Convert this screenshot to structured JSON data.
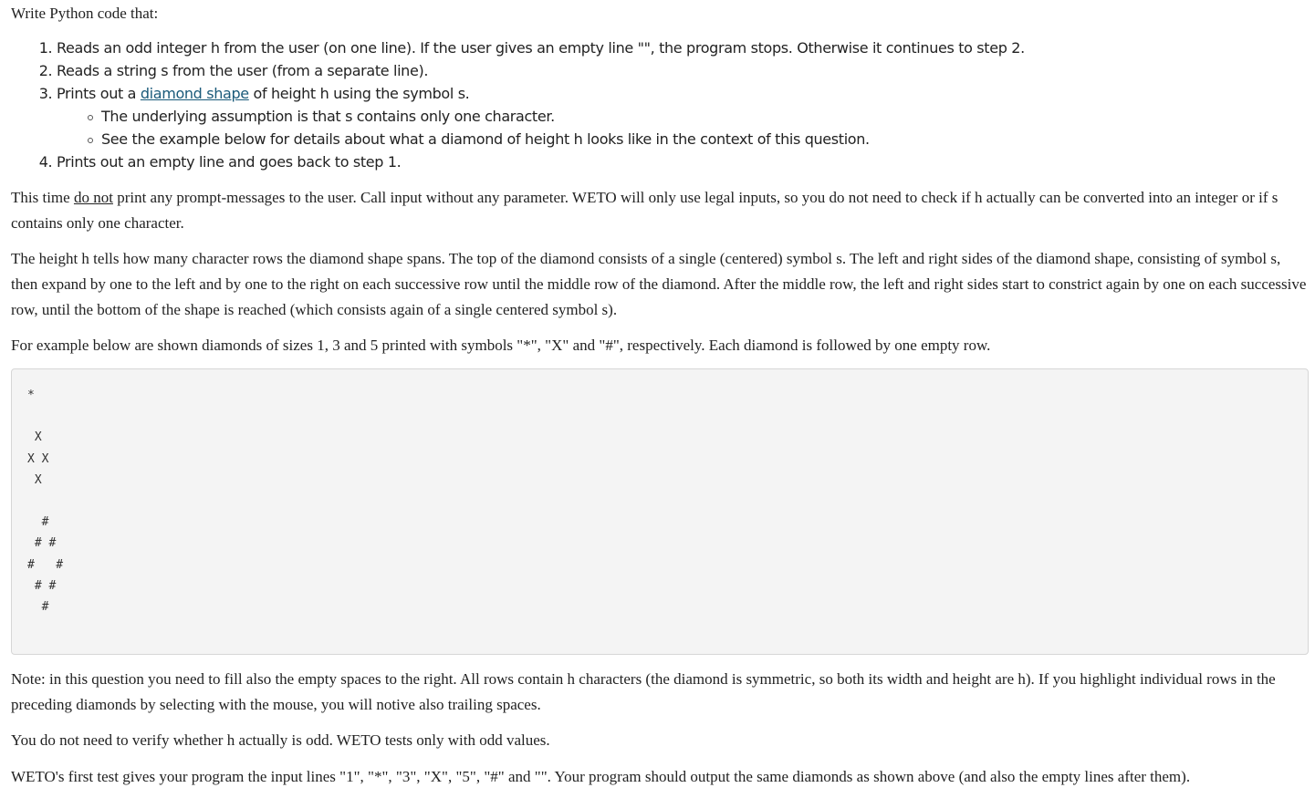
{
  "intro": "Write Python code that:",
  "steps": {
    "s1": "Reads an odd integer h from the user (on one line). If the user gives an empty line \"\", the program stops. Otherwise it continues to step 2.",
    "s2": "Reads a string s from the user (from a separate line).",
    "s3_before": "Prints out a ",
    "s3_link": "diamond shape",
    "s3_after": " of height h using the symbol s.",
    "s3_sub1": "The underlying assumption is that s contains only one character.",
    "s3_sub2": "See the example below for details about what a diamond of height h looks like in the context of this question.",
    "s4": "Prints out an empty line and goes back to step 1."
  },
  "para_prompt": {
    "before": "This time ",
    "underlined": "do not",
    "after": " print any prompt-messages to the user. Call input without any parameter. WETO will only use legal inputs, so you do not need to check if h actually can be converted into an integer or if s contains only one character."
  },
  "para_height": "The height h tells how many character rows the diamond shape spans. The top of the diamond consists of a single (centered) symbol s. The left and right sides of the diamond shape, consisting of symbol s, then expand by one to the left and by one to the right on each successive row until the middle row of the diamond. After the middle row, the left and right sides start to constrict again by one on each successive row, until the bottom of the shape is reached (which consists again of a single centered symbol s).",
  "para_example": "For example below are shown diamonds of sizes 1, 3 and 5 printed with symbols \"*\", \"X\" and \"#\", respectively. Each diamond is followed by one empty row.",
  "code_example": "*\n\n X \nX X\n X \n\n  #  \n # # \n#   #\n # # \n  #  ",
  "para_note": "Note: in this question you need to fill also the empty spaces to the right. All rows contain h characters (the diamond is symmetric, so both its width and height are h). If you highlight individual rows in the preceding diamonds by selecting with the mouse, you will notive also trailing spaces.",
  "para_odd": "You do not need to verify whether h actually is odd. WETO tests only with odd values.",
  "para_test": "WETO's first test gives your program the input lines \"1\", \"*\", \"3\", \"X\", \"5\", \"#\" and \"\". Your program should output the same diamonds as shown above (and also the empty lines after them)."
}
